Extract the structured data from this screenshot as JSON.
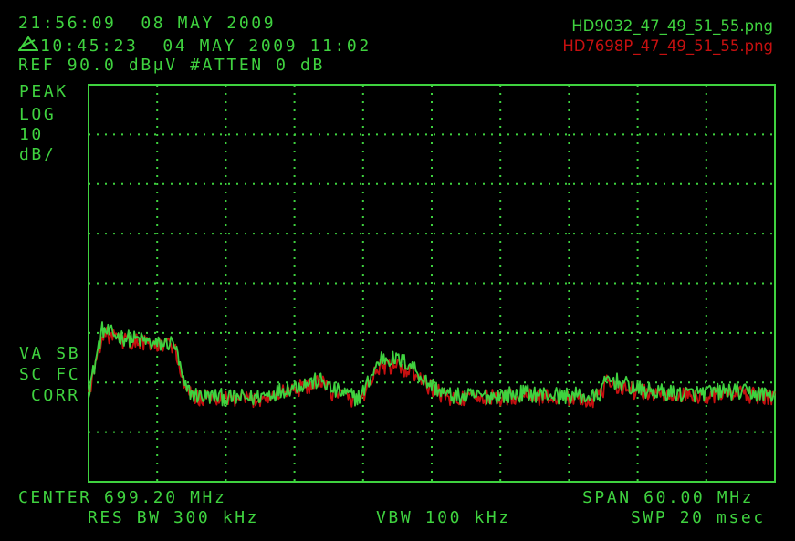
{
  "header": {
    "clock_line": "21:56:09  08 MAY 2009",
    "ref_time_line": "10:45:23  04 MAY 2009 11:02",
    "ref_level_line": "REF 90.0 dBµV #ATTEN 0 dB"
  },
  "files": {
    "trace_green": "HD9032_47_49_51_55.png",
    "trace_red": "HD7698P_47_49_51_55.png"
  },
  "left_annotations": {
    "detector": "PEAK",
    "scale": "LOG",
    "scale_value": "10",
    "scale_unit": "dB/",
    "va_sb": "VA SB",
    "sc_fc": "SC FC",
    "corr": "CORR"
  },
  "footer": {
    "center": "CENTER 699.20 MHz",
    "span": "SPAN 60.00 MHz",
    "res_bw": "RES BW 300 kHz",
    "vbw": "VBW 100 kHz",
    "swp": "SWP 20 msec"
  },
  "colors": {
    "background": "#000000",
    "graticule": "#3fd23f",
    "trace_green": "#3fd23f",
    "trace_red": "#c61010"
  },
  "chart_data": {
    "type": "line",
    "x_unit": "MHz",
    "y_unit": "dBµV",
    "xlim": [
      669.2,
      729.2
    ],
    "ylim": [
      10,
      90
    ],
    "grid": true,
    "divisions": [
      10,
      8
    ],
    "series": [
      {
        "name": "HD9032_47_49_51_55.png",
        "color": "#3fd23f",
        "x": [
          669.2,
          669.6,
          670.4,
          671.0,
          672.0,
          673.0,
          674.0,
          675.0,
          676.0,
          676.7,
          677.0,
          677.6,
          678.4,
          679.5,
          680.5,
          681.5,
          682.5,
          683.5,
          684.5,
          685.5,
          686.5,
          687.5,
          688.5,
          689.6,
          690.5,
          691.5,
          692.5,
          693.0,
          693.4,
          694.3,
          694.8,
          695.5,
          696.5,
          697.5,
          698.5,
          699.5,
          700.5,
          701.5,
          702.5,
          703.5,
          704.5,
          705.5,
          706.5,
          707.5,
          708.5,
          709.5,
          710.5,
          711.5,
          712.5,
          713.5,
          714.0,
          714.5,
          715.5,
          716.5,
          717.5,
          718.5,
          719.5,
          720.5,
          721.5,
          722.5,
          723.5,
          724.5,
          725.5,
          726.5,
          727.5,
          728.5,
          729.2
        ],
        "y": [
          28.5,
          32,
          40.6,
          40,
          39.2,
          38.8,
          38.5,
          37.6,
          37.9,
          38,
          35,
          29,
          27.5,
          27.2,
          27.2,
          26.8,
          27,
          26.8,
          27.5,
          28,
          28.8,
          29.4,
          30,
          30.4,
          28.5,
          27.8,
          27,
          27.2,
          29,
          33,
          35,
          34.8,
          34.4,
          33.5,
          30.5,
          29,
          27.5,
          27.2,
          27.2,
          27.3,
          27.3,
          27.5,
          27.6,
          27.9,
          27.6,
          27.6,
          27.3,
          27.4,
          27.2,
          27,
          28,
          30.6,
          30.2,
          29.2,
          28.5,
          28.2,
          28,
          27.8,
          27.7,
          27.8,
          28,
          28.2,
          28.2,
          28,
          27.8,
          27.6,
          27.4
        ]
      },
      {
        "name": "HD7698P_47_49_51_55.png",
        "color": "#c61010",
        "x": [
          669.2,
          669.6,
          670.4,
          671.0,
          672.0,
          673.0,
          674.0,
          675.0,
          676.0,
          676.7,
          677.0,
          677.6,
          678.4,
          679.5,
          680.5,
          681.5,
          682.5,
          683.5,
          684.5,
          685.5,
          686.5,
          687.5,
          688.5,
          689.6,
          690.5,
          691.5,
          692.5,
          693.0,
          693.4,
          694.3,
          694.8,
          695.5,
          696.5,
          697.5,
          698.5,
          699.5,
          700.5,
          701.5,
          702.5,
          703.5,
          704.5,
          705.5,
          706.5,
          707.5,
          708.5,
          709.5,
          710.5,
          711.5,
          712.5,
          713.5,
          714.0,
          714.5,
          715.5,
          716.5,
          717.5,
          718.5,
          719.5,
          720.5,
          721.5,
          722.5,
          723.5,
          724.5,
          725.5,
          726.5,
          727.5,
          728.5,
          729.2
        ],
        "y": [
          28,
          31.5,
          39.8,
          39.4,
          38.6,
          38.2,
          38,
          37.2,
          37.6,
          37.7,
          34.4,
          28.4,
          27,
          26.8,
          26.8,
          26.4,
          26.6,
          26.4,
          27,
          27.4,
          28.2,
          28.8,
          29.4,
          29.8,
          28,
          27.3,
          26.6,
          26.8,
          28.4,
          32.2,
          33.4,
          33.2,
          32.9,
          32.1,
          29.8,
          28.4,
          27,
          26.8,
          26.8,
          26.9,
          26.9,
          27,
          27.1,
          27.3,
          27.1,
          27.1,
          26.9,
          27,
          26.8,
          26.6,
          27.5,
          29.8,
          29.5,
          28.6,
          28,
          27.7,
          27.5,
          27.3,
          27.2,
          27.3,
          27.5,
          27.7,
          27.7,
          27.5,
          27.3,
          27.1,
          26.9
        ]
      }
    ]
  }
}
